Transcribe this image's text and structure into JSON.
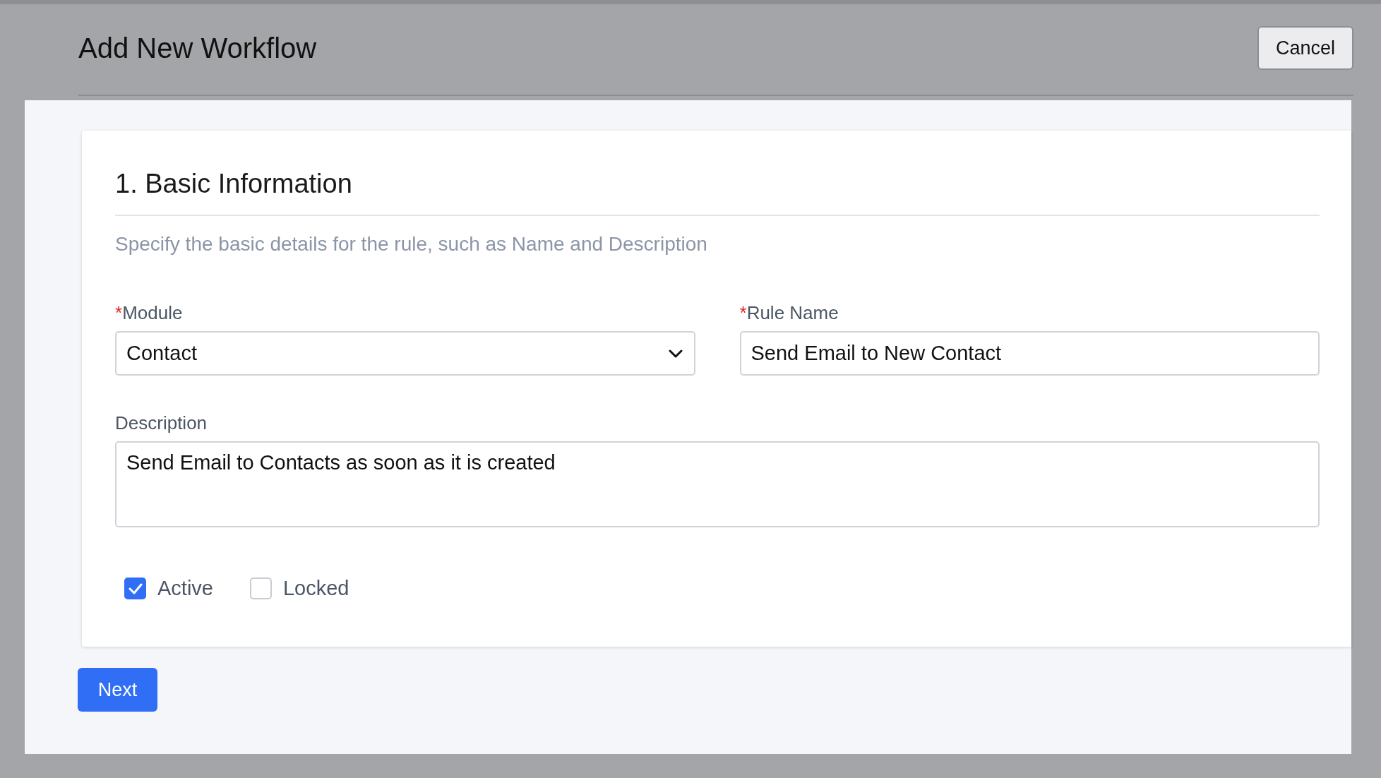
{
  "header": {
    "title": "Add New Workflow",
    "cancel": "Cancel"
  },
  "section": {
    "title": "1. Basic Information",
    "description": "Specify the basic details for the rule, such as Name and Description"
  },
  "fields": [
    {
      "kind": "select",
      "label": "Module",
      "required_mark": "*",
      "value": "Contact"
    },
    {
      "kind": "text",
      "label": "Rule Name",
      "required_mark": "*",
      "value": "Send Email to New Contact"
    },
    {
      "kind": "textarea",
      "label": "Description",
      "value": "Send Email to Contacts as soon as it is created"
    }
  ],
  "checkboxes": [
    {
      "label": "Active",
      "checked": true
    },
    {
      "label": "Locked",
      "checked": false
    }
  ],
  "next": "Next"
}
